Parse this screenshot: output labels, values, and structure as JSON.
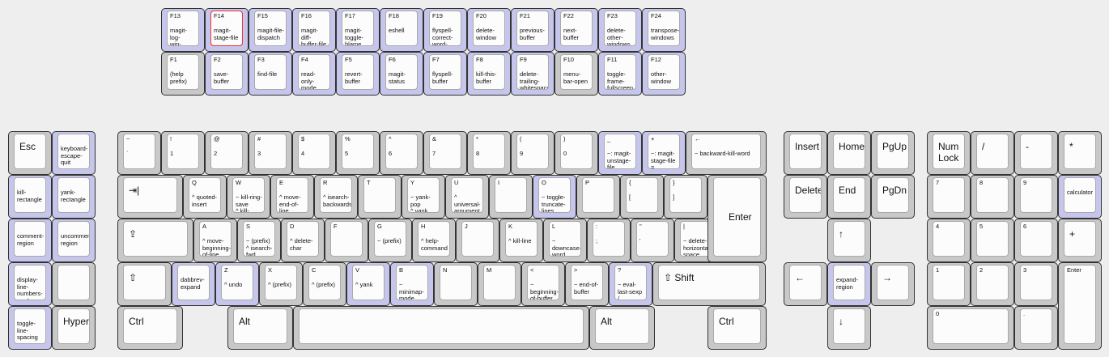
{
  "function_top": [
    {
      "id": "F13",
      "label": "F13",
      "desc": "magit-log-\nwip-\ncurrent",
      "blue": true
    },
    {
      "id": "F14",
      "label": "F14",
      "desc": "magit-\nstage-file",
      "blue": true,
      "active": true
    },
    {
      "id": "F15",
      "label": "F15",
      "desc": "magit-file-\ndispatch",
      "blue": true
    },
    {
      "id": "F16",
      "label": "F16",
      "desc": "magit-diff-\nbuffer-file",
      "blue": true
    },
    {
      "id": "F17",
      "label": "F17",
      "desc": "magit-\ntoggle-\nblame",
      "blue": true
    },
    {
      "id": "F18",
      "label": "F18",
      "desc": "eshell",
      "blue": true
    },
    {
      "id": "F19",
      "label": "F19",
      "desc": "flyspell-\ncorrect-\nword-...",
      "blue": true
    },
    {
      "id": "F20",
      "label": "F20",
      "desc": "delete-\nwindow",
      "blue": true
    },
    {
      "id": "F21",
      "label": "F21",
      "desc": "previous-\nbuffer",
      "blue": true
    },
    {
      "id": "F22",
      "label": "F22",
      "desc": "next-\nbuffer",
      "blue": true
    },
    {
      "id": "F23",
      "label": "F23",
      "desc": "delete-\nother-\nwindows",
      "blue": true
    },
    {
      "id": "F24",
      "label": "F24",
      "desc": "transpose-\nwindows",
      "blue": true
    }
  ],
  "function_bottom": [
    {
      "id": "F1",
      "label": "F1",
      "desc": "(help\nprefix)",
      "blue": false
    },
    {
      "id": "F2",
      "label": "F2",
      "desc": "save-\nbuffer",
      "blue": true
    },
    {
      "id": "F3",
      "label": "F3",
      "desc": "find-file",
      "blue": true
    },
    {
      "id": "F4",
      "label": "F4",
      "desc": "read-only-\nmode",
      "blue": true
    },
    {
      "id": "F5",
      "label": "F5",
      "desc": "revert-\nbuffer",
      "blue": true
    },
    {
      "id": "F6",
      "label": "F6",
      "desc": "magit-\nstatus",
      "blue": true
    },
    {
      "id": "F7",
      "label": "F7",
      "desc": "flyspell-\nbuffer",
      "blue": true
    },
    {
      "id": "F8",
      "label": "F8",
      "desc": "kill-this-\nbuffer",
      "blue": true
    },
    {
      "id": "F9",
      "label": "F9",
      "desc": "delete-\ntrailing-\nwhitespace",
      "blue": true
    },
    {
      "id": "F10",
      "label": "F10",
      "desc": "menu-\nbar-open",
      "blue": false
    },
    {
      "id": "F11",
      "label": "F11",
      "desc": "toggle-\nframe-\nfullscreen",
      "blue": true
    },
    {
      "id": "F12",
      "label": "F12",
      "desc": "other-\nwindow",
      "blue": true
    }
  ],
  "extra_col1": [
    {
      "id": "esc",
      "center": "Esc",
      "blue": false
    },
    {
      "id": "kill-rectangle",
      "desc": "kill-\nrectangle",
      "blue": true
    },
    {
      "id": "comment-region",
      "desc": "comment-\nregion",
      "blue": true
    },
    {
      "id": "display-line-numbers-mode",
      "desc": "display-\nline-\nnumbers-\nmode",
      "blue": true
    },
    {
      "id": "toggle-line-spacing",
      "desc": "toggle-\nline-\nspacing",
      "blue": true
    }
  ],
  "extra_col2": [
    {
      "id": "keyboard-escape-quit",
      "desc": "keyboard-\nescape-\nquit",
      "blue": true
    },
    {
      "id": "yank-rectangle",
      "desc": "yank-\nrectangle",
      "blue": true
    },
    {
      "id": "uncomment-region",
      "desc": "uncomment-\nregion",
      "blue": true
    },
    {
      "id": "blank",
      "desc": "",
      "blue": false
    },
    {
      "id": "hyper",
      "center": "Hyper",
      "blue": false
    }
  ],
  "number_row": [
    {
      "id": "backtick",
      "tl": "~",
      "bl": "`",
      "big": true,
      "blue": false
    },
    {
      "id": "1",
      "tl": "!",
      "bl": "1",
      "blue": false
    },
    {
      "id": "2",
      "tl": "@",
      "bl": "2",
      "blue": false
    },
    {
      "id": "3",
      "tl": "#",
      "bl": "3",
      "blue": false
    },
    {
      "id": "4",
      "tl": "$",
      "bl": "4",
      "blue": false
    },
    {
      "id": "5",
      "tl": "%",
      "bl": "5",
      "blue": false
    },
    {
      "id": "6",
      "tl": "^",
      "bl": "6",
      "blue": false
    },
    {
      "id": "7",
      "tl": "&",
      "bl": "7",
      "blue": false
    },
    {
      "id": "8",
      "tl": "*",
      "bl": "8",
      "blue": false
    },
    {
      "id": "9",
      "tl": "(",
      "bl": "9",
      "blue": false
    },
    {
      "id": "0",
      "tl": ")",
      "bl": "0",
      "blue": false
    },
    {
      "id": "minus",
      "tl": "_",
      "bl": "~: magit-\nunstage-\nfile\n-",
      "blue": true
    },
    {
      "id": "equal",
      "tl": "+",
      "bl": "~: magit-\nstage-file\n=",
      "blue": true
    },
    {
      "id": "backspace",
      "tl": "←",
      "bl": "~ backward-kill-word",
      "blue": false
    }
  ],
  "qwerty_row": [
    {
      "id": "tab",
      "center": "⇥|",
      "blue": false
    },
    {
      "id": "q",
      "tl": "Q",
      "bl": "^ quoted-\ninsert",
      "blue": false
    },
    {
      "id": "w",
      "tl": "W",
      "bl": "~ kill-ring-\nsave\n^ kill-\nregion",
      "blue": false
    },
    {
      "id": "e",
      "tl": "E",
      "bl": "^ move-\nend-of-\nline",
      "blue": false
    },
    {
      "id": "r",
      "tl": "R",
      "bl": "^ isearch-\nbackwards",
      "blue": false
    },
    {
      "id": "t",
      "tl": "T",
      "bl": "",
      "blue": false
    },
    {
      "id": "y",
      "tl": "Y",
      "bl": "~ yank-\npop\n^ yank",
      "blue": false
    },
    {
      "id": "u",
      "tl": "U",
      "bl": "^\nuniversal-\nargument",
      "blue": false
    },
    {
      "id": "i",
      "tl": "I",
      "bl": "",
      "blue": false
    },
    {
      "id": "o",
      "tl": "O",
      "bl": "~ toggle-\ntruncate-\nlines",
      "blue": true
    },
    {
      "id": "p",
      "tl": "P",
      "bl": "",
      "blue": false
    },
    {
      "id": "lbracket",
      "tl": "{",
      "bl": "[",
      "blue": false
    },
    {
      "id": "rbracket",
      "tl": "}",
      "bl": "]",
      "blue": false
    }
  ],
  "home_row": [
    {
      "id": "caps",
      "center": "⇪",
      "blue": false
    },
    {
      "id": "a",
      "tl": "A",
      "bl": "^ move-\nbeginning-\nof-line",
      "blue": false
    },
    {
      "id": "s",
      "tl": "S",
      "bl": "~ (prefix)\n^ isearch-\nfwd",
      "blue": false
    },
    {
      "id": "d",
      "tl": "D",
      "bl": "^ delete-\nchar",
      "blue": false
    },
    {
      "id": "f",
      "tl": "F",
      "bl": "",
      "blue": false
    },
    {
      "id": "g",
      "tl": "G",
      "bl": "~ (prefix)",
      "blue": false
    },
    {
      "id": "h",
      "tl": "H",
      "bl": "^ help-\ncommand",
      "blue": false
    },
    {
      "id": "j",
      "tl": "J",
      "bl": "",
      "blue": false
    },
    {
      "id": "k",
      "tl": "K",
      "bl": "^ kill-line",
      "blue": false
    },
    {
      "id": "l",
      "tl": "L",
      "bl": "~\ndowncase-\nword\n^ recenter",
      "blue": false
    },
    {
      "id": "semicolon",
      "tl": ":",
      "bl": ";",
      "blue": false
    },
    {
      "id": "quote",
      "tl": "\"",
      "bl": "'",
      "blue": false
    },
    {
      "id": "backslash",
      "tl": "|",
      "bl": "~ delete-\nhorizontal-\nspace\n\\",
      "blue": false
    }
  ],
  "enter_label": "Enter",
  "shift_row": [
    {
      "id": "lshift",
      "center": "⇧",
      "blue": false
    },
    {
      "id": "dabbrev",
      "desc": "dabbrev-\nexpand",
      "blue": true
    },
    {
      "id": "z",
      "tl": "Z",
      "bl": "^ undo",
      "blue": true
    },
    {
      "id": "x",
      "tl": "X",
      "bl": "^ (prefix)",
      "blue": false
    },
    {
      "id": "c",
      "tl": "C",
      "bl": "^ (prefix)",
      "blue": false
    },
    {
      "id": "v",
      "tl": "V",
      "bl": "^ yank",
      "blue": true
    },
    {
      "id": "b",
      "tl": "B",
      "bl": "~\nminimap-\nmode",
      "blue": true
    },
    {
      "id": "n",
      "tl": "N",
      "bl": "",
      "blue": false
    },
    {
      "id": "m",
      "tl": "M",
      "bl": "",
      "blue": false
    },
    {
      "id": "comma",
      "tl": "<",
      "bl": "~\nbeginning-\nof-buffer\n,",
      "blue": false
    },
    {
      "id": "period",
      "tl": ">",
      "bl": "~ end-of-\nbuffer\n.",
      "blue": false
    },
    {
      "id": "slash",
      "tl": "?",
      "bl": "~ eval-\nlast-sexp\n/",
      "blue": true
    },
    {
      "id": "rshift",
      "center": "⇧ Shift",
      "blue": false
    }
  ],
  "bottom_row": [
    {
      "id": "lctrl",
      "center": "Ctrl",
      "blue": false
    },
    {
      "id": "lalt",
      "center": "Alt",
      "blue": false
    },
    {
      "id": "space",
      "center": "",
      "blue": false
    },
    {
      "id": "ralt",
      "center": "Alt",
      "blue": false
    },
    {
      "id": "rctrl",
      "center": "Ctrl",
      "blue": false
    }
  ],
  "nav_cluster": [
    {
      "id": "insert",
      "center": "Insert",
      "blue": false
    },
    {
      "id": "home",
      "center": "Home",
      "blue": false
    },
    {
      "id": "pgup",
      "center": "PgUp",
      "blue": false
    },
    {
      "id": "delete",
      "center": "Delete",
      "blue": false
    },
    {
      "id": "end",
      "center": "End",
      "blue": false
    },
    {
      "id": "pgdn",
      "center": "PgDn",
      "blue": false
    },
    {
      "id": "up",
      "center": "↑",
      "blue": false
    },
    {
      "id": "left",
      "center": "←",
      "blue": false
    },
    {
      "id": "expand-region",
      "desc": "expand-\nregion",
      "blue": true
    },
    {
      "id": "right",
      "center": "→",
      "blue": false
    },
    {
      "id": "down",
      "center": "↓",
      "blue": false
    }
  ],
  "numpad": [
    {
      "id": "numlock",
      "center": "Num\nLock",
      "blue": false
    },
    {
      "id": "np-div",
      "center": "/",
      "blue": false
    },
    {
      "id": "np-mul",
      "center": "-",
      "blue": false
    },
    {
      "id": "np-sub",
      "center": "*",
      "blue": false
    },
    {
      "id": "np7",
      "tl": "7",
      "blue": false
    },
    {
      "id": "np8",
      "tl": "8",
      "blue": false
    },
    {
      "id": "np9",
      "tl": "9",
      "blue": false
    },
    {
      "id": "calculator",
      "desc": "calculator",
      "blue": true
    },
    {
      "id": "np4",
      "tl": "4",
      "blue": false
    },
    {
      "id": "np5",
      "tl": "5",
      "blue": false
    },
    {
      "id": "np6",
      "tl": "6",
      "blue": false
    },
    {
      "id": "np-add",
      "center": "+",
      "blue": false
    },
    {
      "id": "np1",
      "tl": "1",
      "blue": false
    },
    {
      "id": "np2",
      "tl": "2",
      "blue": false
    },
    {
      "id": "np3",
      "tl": "3",
      "blue": false
    },
    {
      "id": "np-enter",
      "tl": "Enter",
      "blue": false
    },
    {
      "id": "np0",
      "tl": "0",
      "blue": false
    },
    {
      "id": "np-dot",
      "tl": ".",
      "blue": false
    }
  ],
  "colors": {
    "blue_key": "#c6c6ec",
    "gray_key": "#c8c8c8",
    "active_outline": "#e33333"
  }
}
